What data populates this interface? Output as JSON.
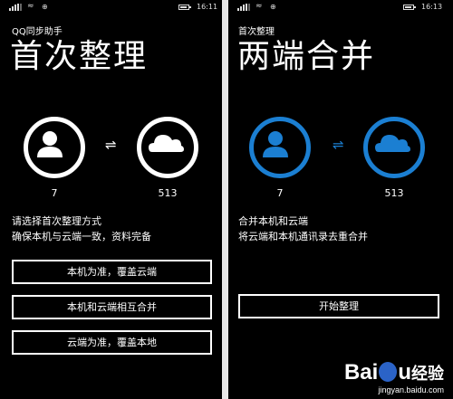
{
  "left": {
    "status": {
      "time": "16:11"
    },
    "app_title": "QQ同步助手",
    "page_title": "首次整理",
    "local": {
      "icon": "contact-icon",
      "count": "7"
    },
    "sync_icon": "sync-arrows-icon",
    "cloud": {
      "icon": "cloud-icon",
      "count": "513"
    },
    "description": [
      "请选择首次整理方式",
      "确保本机与云端一致，资料完备"
    ],
    "buttons": [
      "本机为准，覆盖云端",
      "本机和云端相互合并",
      "云端为准，覆盖本地"
    ],
    "accent": "#ffffff"
  },
  "right": {
    "status": {
      "time": "16:13"
    },
    "app_title": "首次整理",
    "page_title": "两端合并",
    "local": {
      "icon": "contact-icon",
      "count": "7"
    },
    "sync_icon": "sync-arrows-icon",
    "cloud": {
      "icon": "cloud-icon",
      "count": "513"
    },
    "description": [
      "合并本机和云端",
      "将云端和本机通讯录去重合并"
    ],
    "buttons": [
      "开始整理"
    ],
    "accent": "#1b7fd2"
  },
  "watermark": {
    "logo": "Baidu经验",
    "url": "jingyan.baidu.com"
  },
  "colors": {
    "background": "#000000",
    "text": "#ffffff",
    "accent_blue": "#1b7fd2",
    "divider": "#e9e9e9"
  }
}
